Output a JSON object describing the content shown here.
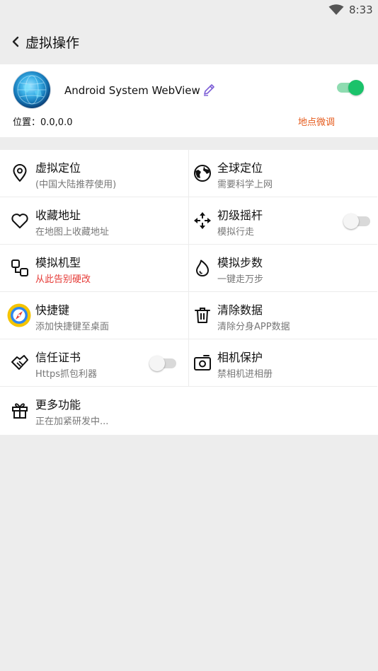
{
  "status_bar": {
    "time": "8:33",
    "wifi_icon": "wifi-icon"
  },
  "app_bar": {
    "title": "虚拟操作",
    "back_icon": "chevron-left-icon"
  },
  "app_card": {
    "app_name": "Android System WebView",
    "position_label": "位置：0.0,0.0",
    "fine_tune_label": "地点微调",
    "fine_tune_color": "#e55a1b",
    "enabled": true,
    "accent_color": "#1bc26a"
  },
  "features": [
    {
      "title": "虚拟定位",
      "subtitle": "(中国大陆推荐使用)",
      "icon": "location-pin-icon"
    },
    {
      "title": "全球定位",
      "subtitle": "需要科学上网",
      "icon": "globe-icon"
    },
    {
      "title": "收藏地址",
      "subtitle": "在地图上收藏地址",
      "icon": "heart-icon"
    },
    {
      "title": "初级摇杆",
      "subtitle": "模拟行走",
      "icon": "move-arrows-icon",
      "toggle": false
    },
    {
      "title": "模拟机型",
      "subtitle": "从此告别硬改",
      "icon": "device-model-icon",
      "subtitle_color": "#e53935"
    },
    {
      "title": "模拟步数",
      "subtitle": "一键走万步",
      "icon": "flame-icon"
    },
    {
      "title": "快捷键",
      "subtitle": "添加快捷键至桌面",
      "icon": "compass-app-icon"
    },
    {
      "title": "清除数据",
      "subtitle": "清除分身APP数据",
      "icon": "trash-icon"
    },
    {
      "title": "信任证书",
      "subtitle": "Https抓包利器",
      "icon": "certificate-icon",
      "toggle": false
    },
    {
      "title": "相机保护",
      "subtitle": "禁相机进相册",
      "icon": "camera-icon"
    },
    {
      "title": "更多功能",
      "subtitle": "正在加紧研发中...",
      "icon": "gift-icon"
    }
  ]
}
